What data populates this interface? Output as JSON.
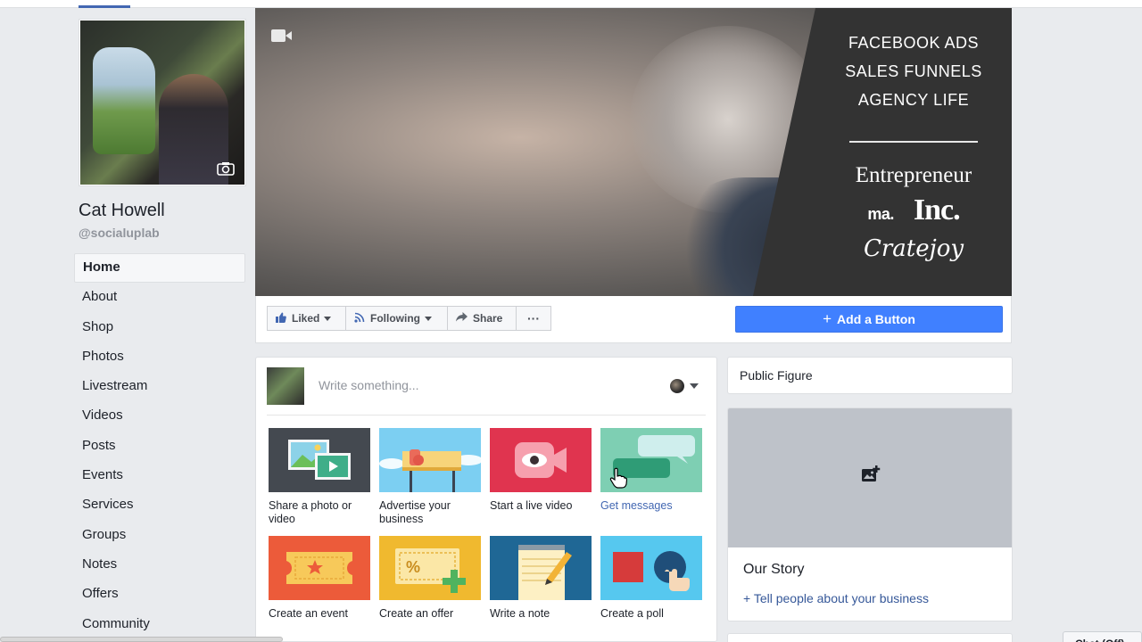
{
  "page": {
    "name": "Cat Howell",
    "handle": "@socialuplab"
  },
  "nav": {
    "items": [
      {
        "label": "Home",
        "active": true
      },
      {
        "label": "About"
      },
      {
        "label": "Shop"
      },
      {
        "label": "Photos"
      },
      {
        "label": "Livestream"
      },
      {
        "label": "Videos"
      },
      {
        "label": "Posts"
      },
      {
        "label": "Events"
      },
      {
        "label": "Services"
      },
      {
        "label": "Groups"
      },
      {
        "label": "Notes"
      },
      {
        "label": "Offers"
      },
      {
        "label": "Community"
      }
    ]
  },
  "cover": {
    "lines": [
      "FACEBOOK ADS",
      "SALES FUNNELS",
      "AGENCY LIFE"
    ],
    "logos": {
      "entrepreneur": "Entrepreneur",
      "ma": "ma.",
      "inc": "Inc.",
      "cratejoy": "Cratejoy"
    }
  },
  "actions": {
    "liked": "Liked",
    "following": "Following",
    "share": "Share",
    "more": "···",
    "add_button": "Add a Button"
  },
  "composer": {
    "placeholder": "Write something...",
    "tiles": [
      {
        "label": "Share a photo or video"
      },
      {
        "label": "Advertise your business"
      },
      {
        "label": "Start a live video"
      },
      {
        "label": "Get messages",
        "link": true
      },
      {
        "label": "Create an event"
      },
      {
        "label": "Create an offer"
      },
      {
        "label": "Write a note"
      },
      {
        "label": "Create a poll"
      }
    ]
  },
  "sidebar": {
    "category": "Public Figure",
    "story_title": "Our Story",
    "story_link": "+ Tell people about your business"
  },
  "chat": {
    "label": "Chat (Off)"
  },
  "colors": {
    "brand": "#4267b2",
    "add_button": "#4080ff",
    "background": "#e9ebee"
  }
}
